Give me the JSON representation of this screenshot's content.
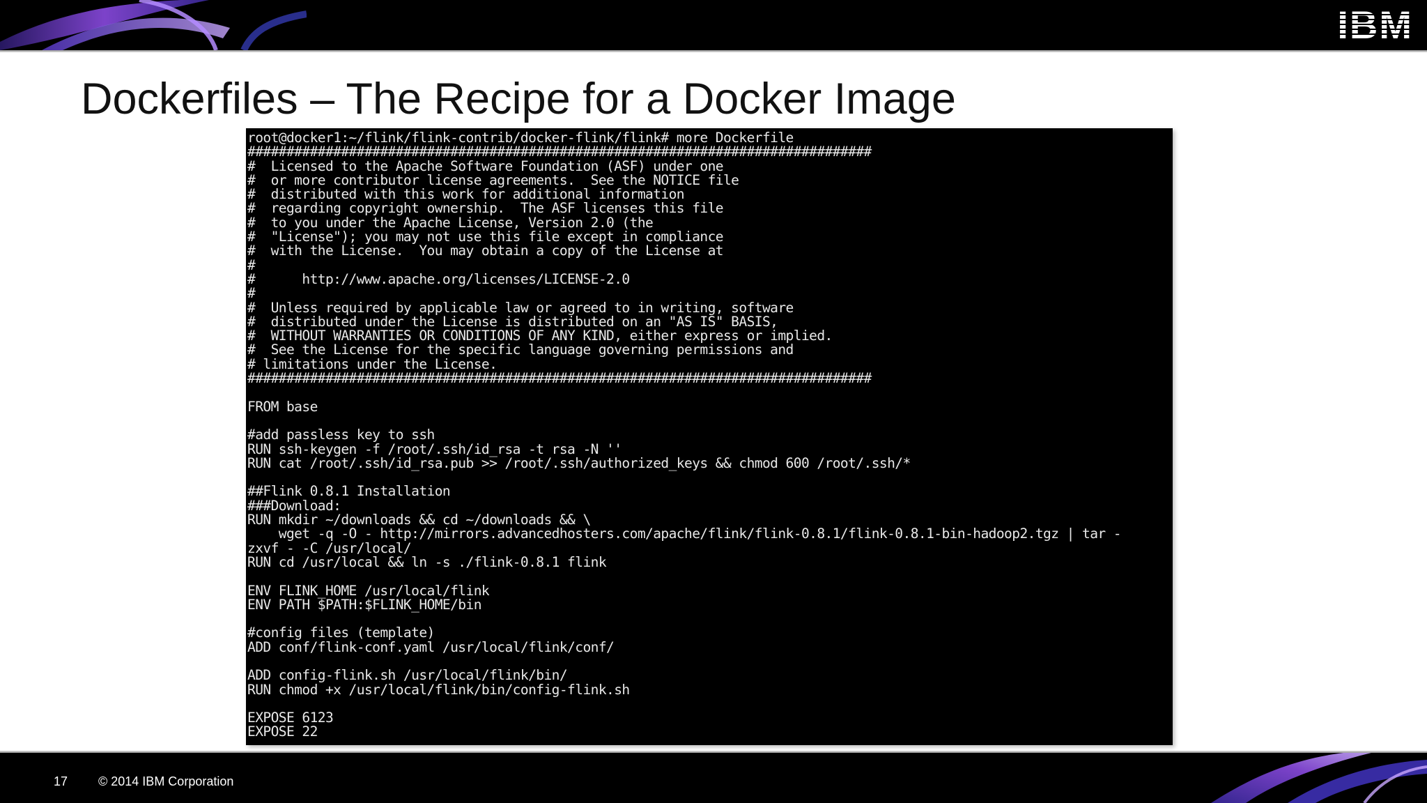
{
  "header": {
    "logo_text": "IBM",
    "logo_icon": "ibm-striped-logo"
  },
  "slide": {
    "title": "Dockerfiles – The Recipe for a Docker Image"
  },
  "terminal": {
    "lines": [
      "root@docker1:~/flink/flink-contrib/docker-flink/flink# more Dockerfile",
      "################################################################################",
      "#  Licensed to the Apache Software Foundation (ASF) under one",
      "#  or more contributor license agreements.  See the NOTICE file",
      "#  distributed with this work for additional information",
      "#  regarding copyright ownership.  The ASF licenses this file",
      "#  to you under the Apache License, Version 2.0 (the",
      "#  \"License\"); you may not use this file except in compliance",
      "#  with the License.  You may obtain a copy of the License at",
      "#",
      "#      http://www.apache.org/licenses/LICENSE-2.0",
      "#",
      "#  Unless required by applicable law or agreed to in writing, software",
      "#  distributed under the License is distributed on an \"AS IS\" BASIS,",
      "#  WITHOUT WARRANTIES OR CONDITIONS OF ANY KIND, either express or implied.",
      "#  See the License for the specific language governing permissions and",
      "# limitations under the License.",
      "################################################################################",
      "",
      "FROM base",
      "",
      "#add passless key to ssh",
      "RUN ssh-keygen -f /root/.ssh/id_rsa -t rsa -N ''",
      "RUN cat /root/.ssh/id_rsa.pub >> /root/.ssh/authorized_keys && chmod 600 /root/.ssh/*",
      "",
      "##Flink 0.8.1 Installation",
      "###Download:",
      "RUN mkdir ~/downloads && cd ~/downloads && \\",
      "    wget -q -O - http://mirrors.advancedhosters.com/apache/flink/flink-0.8.1/flink-0.8.1-bin-hadoop2.tgz | tar -",
      "zxvf - -C /usr/local/",
      "RUN cd /usr/local && ln -s ./flink-0.8.1 flink",
      "",
      "ENV FLINK_HOME /usr/local/flink",
      "ENV PATH $PATH:$FLINK_HOME/bin",
      "",
      "#config files (template)",
      "ADD conf/flink-conf.yaml /usr/local/flink/conf/",
      "",
      "ADD config-flink.sh /usr/local/flink/bin/",
      "RUN chmod +x /usr/local/flink/bin/config-flink.sh",
      "",
      "EXPOSE 6123",
      "EXPOSE 22"
    ]
  },
  "footer": {
    "page_number": "17",
    "copyright": "© 2014 IBM Corporation"
  },
  "colors": {
    "bar_background": "#000000",
    "swoosh_purple": "#7b3fd6",
    "swoosh_blue": "#3e4fd8",
    "terminal_text": "#e8e8e8"
  }
}
